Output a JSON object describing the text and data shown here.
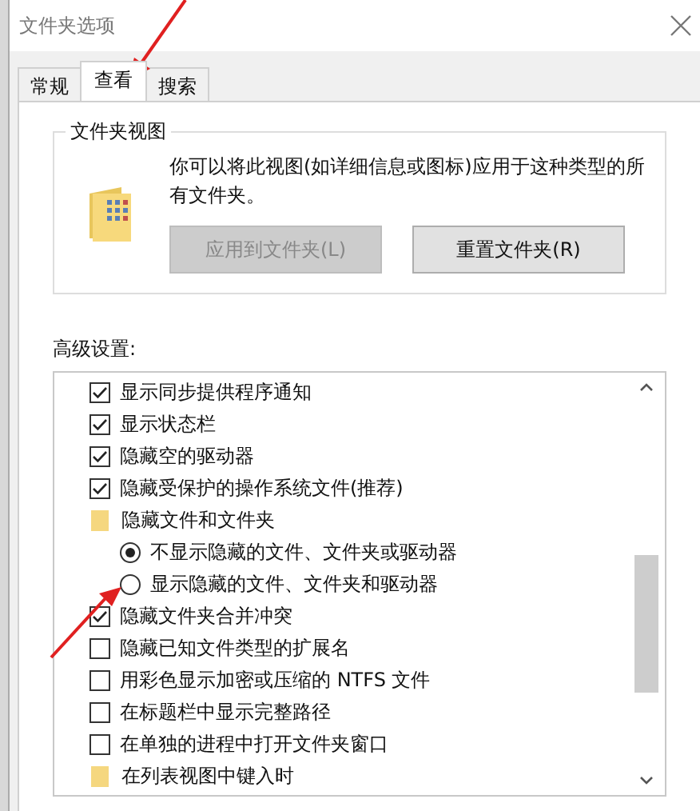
{
  "window": {
    "title": "文件夹选项"
  },
  "tabs": [
    {
      "label": "常规",
      "selected": false
    },
    {
      "label": "查看",
      "selected": true
    },
    {
      "label": "搜索",
      "selected": false
    }
  ],
  "folder_views": {
    "title": "文件夹视图",
    "description": "你可以将此视图(如详细信息或图标)应用于这种类型的所有文件夹。",
    "buttons": [
      {
        "label": "应用到文件夹(L)",
        "disabled": true
      },
      {
        "label": "重置文件夹(R)",
        "disabled": false
      }
    ]
  },
  "advanced": {
    "label": "高级设置:",
    "items": [
      {
        "kind": "checkbox",
        "label": "显示同步提供程序通知",
        "checked": true
      },
      {
        "kind": "checkbox",
        "label": "显示状态栏",
        "checked": true
      },
      {
        "kind": "checkbox",
        "label": "隐藏空的驱动器",
        "checked": true
      },
      {
        "kind": "checkbox",
        "label": "隐藏受保护的操作系统文件(推荐)",
        "checked": true
      },
      {
        "kind": "group",
        "label": "隐藏文件和文件夹"
      },
      {
        "kind": "radio",
        "label": "不显示隐藏的文件、文件夹或驱动器",
        "selected": true
      },
      {
        "kind": "radio",
        "label": "显示隐藏的文件、文件夹和驱动器",
        "selected": false
      },
      {
        "kind": "checkbox",
        "label": "隐藏文件夹合并冲突",
        "checked": true
      },
      {
        "kind": "checkbox",
        "label": "隐藏已知文件类型的扩展名",
        "checked": false
      },
      {
        "kind": "checkbox",
        "label": "用彩色显示加密或压缩的 NTFS 文件",
        "checked": false
      },
      {
        "kind": "checkbox",
        "label": "在标题栏中显示完整路径",
        "checked": false
      },
      {
        "kind": "checkbox",
        "label": "在单独的进程中打开文件夹窗口",
        "checked": false
      },
      {
        "kind": "group",
        "label": "在列表视图中键入时"
      }
    ]
  }
}
